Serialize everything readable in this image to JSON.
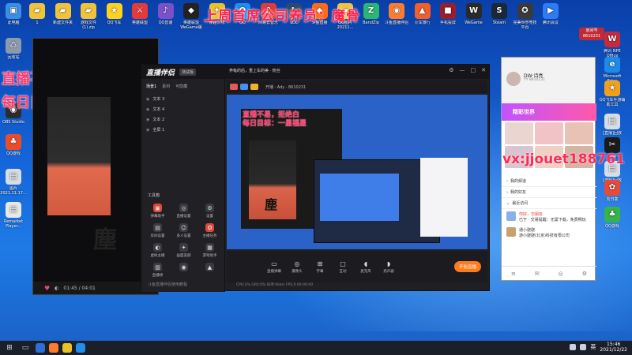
{
  "overlay": {
    "top_text": "上周首席公司养员：魔骨",
    "left_line1": "直播不易，拒绝白嫖",
    "left_line2": "每日目标：一星福星",
    "right_text": "vx:jjouet188761"
  },
  "desktop_icons_left": [
    {
      "label": "此电脑",
      "color": "#3a8ee6",
      "glyph": "▣"
    },
    {
      "label": "回收站",
      "color": "#8c9aad",
      "glyph": "♺"
    },
    {
      "label": "OBS Studio",
      "color": "#2c2c2c",
      "glyph": "◉"
    },
    {
      "label": "QQ游戏",
      "color": "#e94d2c",
      "glyph": "♣"
    },
    {
      "label": "图片 2021.11.17...",
      "color": "#d6dde6",
      "glyph": "▤"
    },
    {
      "label": "Remarket Player...",
      "color": "#e8e8e8",
      "glyph": "▤"
    }
  ],
  "desktop_icons_top": [
    {
      "label": "1",
      "color": "#f0c33c",
      "glyph": "▰"
    },
    {
      "label": "新建文件夹",
      "color": "#f0c33c",
      "glyph": "▰"
    },
    {
      "label": "游戏文件 (1).zip",
      "color": "#f0c33c",
      "glyph": "▰"
    },
    {
      "label": "QQ飞车",
      "color": "#ffd21f",
      "glyph": "★"
    },
    {
      "label": "英雄联盟",
      "color": "#e63a3a",
      "glyph": "⚔"
    },
    {
      "label": "QQ音速",
      "color": "#7b50c9",
      "glyph": "♪"
    },
    {
      "label": "英雄联盟WeGame版",
      "color": "#222",
      "glyph": "◆"
    },
    {
      "label": "穿越火线",
      "color": "#e8c228",
      "glyph": "✦"
    },
    {
      "label": "QQ",
      "color": "#1f8ef1",
      "glyph": "Q"
    },
    {
      "label": "网易云音乐",
      "color": "#e23a3a",
      "glyph": "♫"
    },
    {
      "label": "LOL",
      "color": "#2a4a72",
      "glyph": "L"
    },
    {
      "label": "斗鱼直播",
      "color": "#ff6a1a",
      "glyph": "◆"
    },
    {
      "label": "QQ图片 20211...",
      "color": "#f0c33c",
      "glyph": "▰"
    },
    {
      "label": "BandZip",
      "color": "#2bb673",
      "glyph": "Z"
    },
    {
      "label": "斗鱼直播伴侣",
      "color": "#ff7b2e",
      "glyph": "◉"
    },
    {
      "label": "火车旅行",
      "color": "#f25f2c",
      "glyph": "▲"
    },
    {
      "label": "手机投屏",
      "color": "#9b1e2a",
      "glyph": "■"
    },
    {
      "label": "WeGame",
      "color": "#2a2a2a",
      "glyph": "W"
    },
    {
      "label": "Steam",
      "color": "#1b2838",
      "glyph": "S"
    },
    {
      "label": "完美世界竞技平台",
      "color": "#3a3a3a",
      "glyph": "✪"
    },
    {
      "label": "腾讯会议",
      "color": "#2f7bf5",
      "glyph": "▶"
    }
  ],
  "desktop_icons_right": [
    {
      "label": "腾讯 NPE Office",
      "color": "#c72a3a",
      "glyph": "W"
    },
    {
      "label": "Microsoft Edge",
      "color": "#1d8ae8",
      "glyph": "e"
    },
    {
      "label": "QQ飞车手游辅助工具",
      "color": "#f2a01c",
      "glyph": "★"
    },
    {
      "label": "[直播]回放",
      "color": "#d6dde6",
      "glyph": "▤"
    },
    {
      "label": "剪映",
      "color": "#1b1b1b",
      "glyph": "✂"
    },
    {
      "label": "[游戏]回放",
      "color": "#d6dde6",
      "glyph": "▤"
    },
    {
      "label": "向日葵",
      "color": "#e84a3a",
      "glyph": "✿"
    },
    {
      "label": "QQ游戏",
      "color": "#36b34a",
      "glyph": "♣"
    }
  ],
  "yy_badge": {
    "line1": "房间号",
    "line2": "8610231"
  },
  "player": {
    "glyph": "塵",
    "time": "01:45 / 04:01"
  },
  "app": {
    "title": "直播伴侣",
    "version": "测试版",
    "user_line": "养龟的后，重上车的美 · 粉丝",
    "scene_tabs": [
      "场景1",
      "素材",
      "可隐藏"
    ],
    "scenes": [
      "文本 3",
      "文本 4",
      "文本 2",
      "全屏 1"
    ],
    "tools_title": "工具箱",
    "tools": [
      "弹幕助手",
      "直播设置",
      "设置",
      "房间设置",
      "多人设置",
      "主播任务",
      "虚拟主播",
      "画面美颜",
      "游戏助手",
      "直播榜",
      "",
      ""
    ],
    "preview_sub": "开播 · Ady · 8610231",
    "nested_text_line1": "直播不易，拒绝白",
    "nested_text_line2": "每日目标：一星福星",
    "nested_glyph": "塵",
    "bottom_buttons": [
      "直播弹幕",
      "摄像头",
      "字幕",
      "互动",
      "麦克风",
      "扬声器"
    ],
    "start_live": "开始直播",
    "tip": "斗鱼直播伴侣使用教程",
    "status": "CPU:2%  GPU:0%  码率:0kb/s  FPS:0  00:00:00"
  },
  "chat": {
    "name": "DW·诗亮",
    "sub": "YY 8610231",
    "banner": "精彩世界",
    "rows": [
      "我的频道",
      "我的好友",
      "最近访问"
    ],
    "msg1_title": "你好，交朋友",
    "msg1_text": "已于 · 交易提醒：无需下载，免费畅玩",
    "msg2_title": "通小骁骁",
    "msg2_text": "游小骁骁(北京)科技有限公司"
  },
  "taskbar": {
    "time": "15:46",
    "date": "2021/12/22",
    "lang": "英"
  }
}
